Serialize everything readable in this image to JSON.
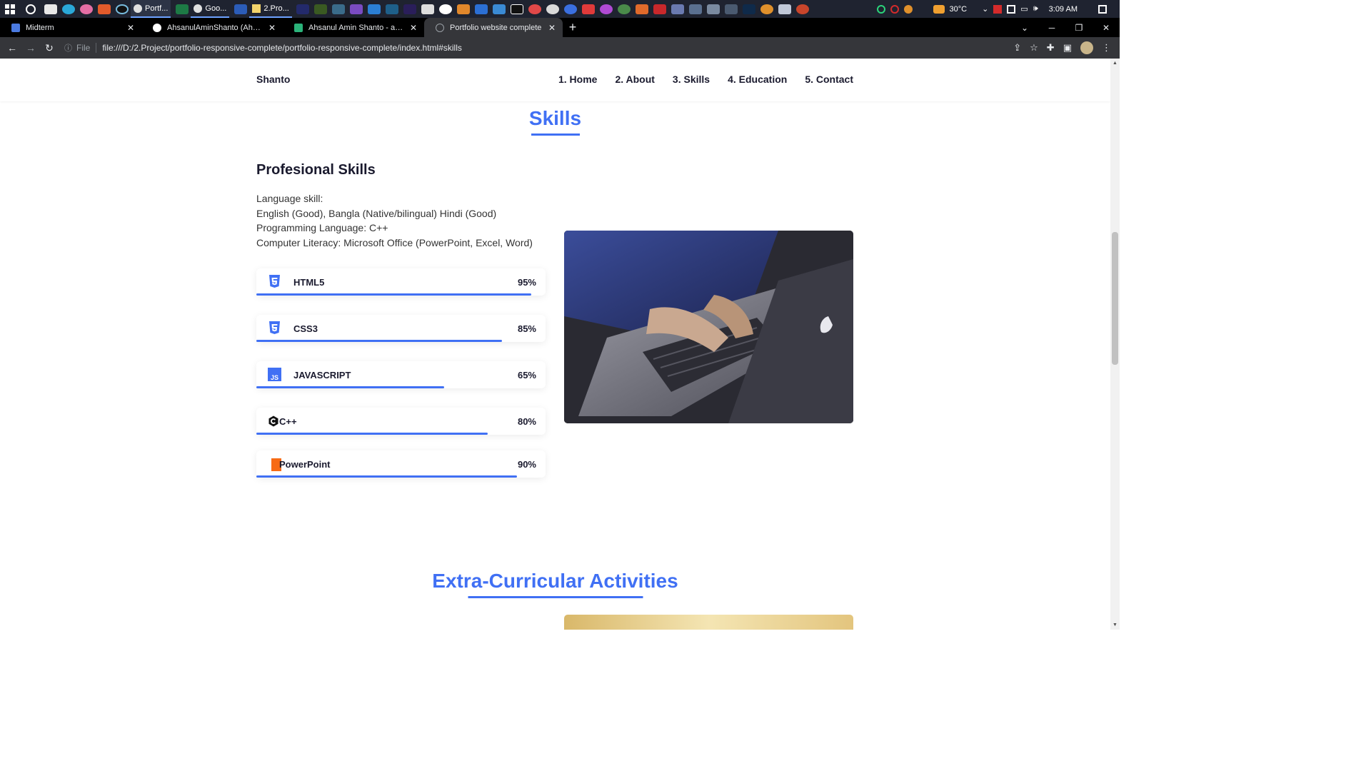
{
  "taskbar": {
    "apps": [
      {
        "label": "Portf...",
        "icon": "chrome-icon"
      },
      {
        "label": "Goo...",
        "icon": "chrome-icon"
      },
      {
        "label": "2.Pro...",
        "icon": "folder-icon"
      }
    ],
    "weather": "30°C",
    "time": "3:09 AM"
  },
  "browser": {
    "tabs": [
      {
        "title": "Midterm",
        "active": false
      },
      {
        "title": "AhsanulAminShanto (Ahsanul Am",
        "active": false
      },
      {
        "title": "Ahsanul Amin Shanto - ahsanula",
        "active": false
      },
      {
        "title": "Portfolio website complete",
        "active": true
      }
    ],
    "address": {
      "scheme_label": "File",
      "url": "file:///D:/2.Project/portfolio-responsive-complete/portfolio-responsive-complete/index.html#skills"
    }
  },
  "site": {
    "logo": "Shanto",
    "nav": [
      "1. Home",
      "2. About",
      "3. Skills",
      "4. Education",
      "5. Contact"
    ],
    "skills_title": "Skills",
    "professional": {
      "heading": "Profesional Skills",
      "lines": [
        "Language skill:",
        "English (Good), Bangla (Native/bilingual) Hindi (Good)",
        "Programming Language: C++",
        "Computer Literacy: Microsoft Office (PowerPoint, Excel, Word)"
      ]
    },
    "skills": [
      {
        "name": "HTML5",
        "percent": "95%",
        "level": 0.95,
        "icon": "html5-icon"
      },
      {
        "name": "CSS3",
        "percent": "85%",
        "level": 0.85,
        "icon": "css3-icon"
      },
      {
        "name": "JAVASCRIPT",
        "percent": "65%",
        "level": 0.65,
        "icon": "javascript-icon"
      },
      {
        "name": "C++",
        "percent": "80%",
        "level": 0.8,
        "icon": "cpp-icon"
      },
      {
        "name": "PowerPoint",
        "percent": "90%",
        "level": 0.9,
        "icon": "powerpoint-icon"
      }
    ],
    "extra_title": "Extra-Curricular Activities"
  },
  "colors": {
    "accent": "#4070f4",
    "text": "#1a1a2e"
  }
}
